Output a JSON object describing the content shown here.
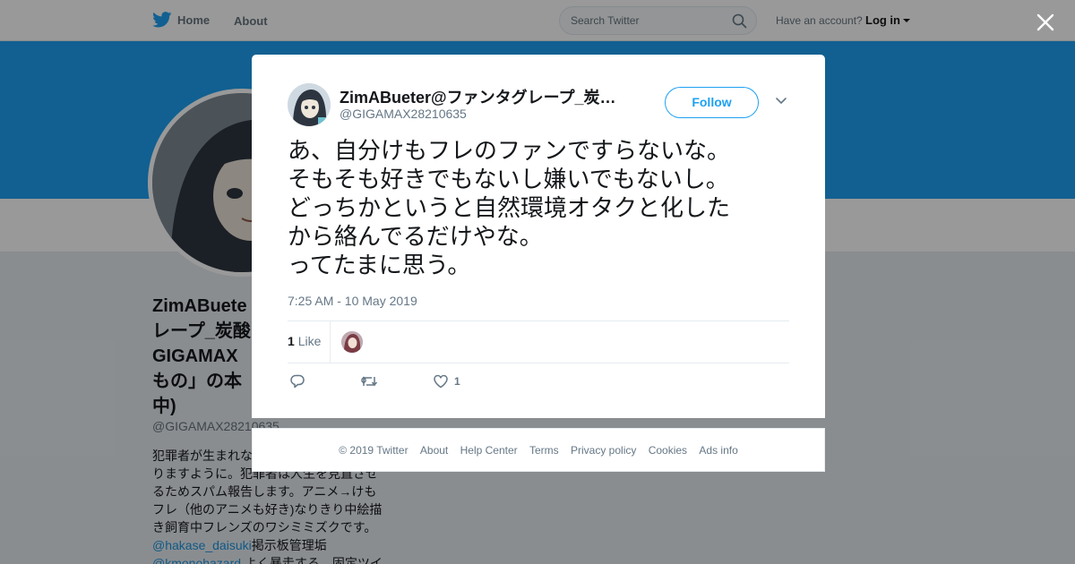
{
  "topbar": {
    "home_label": "Home",
    "about_label": "About",
    "search_placeholder": "Search Twitter",
    "have_account": "Have an account?",
    "login_label": "Log in"
  },
  "profile": {
    "name": "ZimABueter@ファンタグレープ_炭酸GIGAMAX「もの」の本気中)",
    "name_lines": [
      "ZimABuete",
      "レープ_炭酸",
      "GIGAMAX",
      "もの」の本",
      "中)"
    ],
    "handle": "@GIGAMAX28210635",
    "bio_lines": [
      "犯罪者が生まれな",
      "りますように。犯罪者は人生を見直させ",
      "るためスパム報告します。アニメ→けも",
      "フレ（他のアニメも好き)なりきり中絵描",
      "き飼育中フレンズのワシミミズクです。"
    ],
    "bio_link1": "@hakase_daisuki",
    "bio_link1_after": "掲示板管理垢",
    "bio_link2": "@kmonohazard",
    "bio_link2_after": " よく暴走する、固定ツイ"
  },
  "tweet": {
    "author_name": "ZimABueter@ファンタグレープ_炭…",
    "author_handle": "@GIGAMAX28210635",
    "follow_label": "Follow",
    "text_lines": [
      "あ、自分けもフレのファンですらないな。",
      "そもそも好きでもないし嫌いでもないし。",
      "どっちかというと自然環境オタクと化した",
      "から絡んでるだけやな。",
      "ってたまに思う。"
    ],
    "timestamp": "7:25 AM - 10 May 2019",
    "like_count": "1",
    "like_label": "Like",
    "action_like_count": "1"
  },
  "footer": {
    "links": [
      "© 2019 Twitter",
      "About",
      "Help Center",
      "Terms",
      "Privacy policy",
      "Cookies",
      "Ads info"
    ]
  },
  "colors": {
    "brand": "#1da1f2",
    "banner": "#1da1f2",
    "text_secondary": "#657786"
  },
  "icons": {
    "logo": "twitter-bird-icon",
    "search": "magnifier-icon",
    "close": "close-x-icon",
    "more": "chevron-down-icon",
    "reply": "speech-bubble-icon",
    "retweet": "retweet-arrows-icon",
    "like": "heart-outline-icon"
  }
}
